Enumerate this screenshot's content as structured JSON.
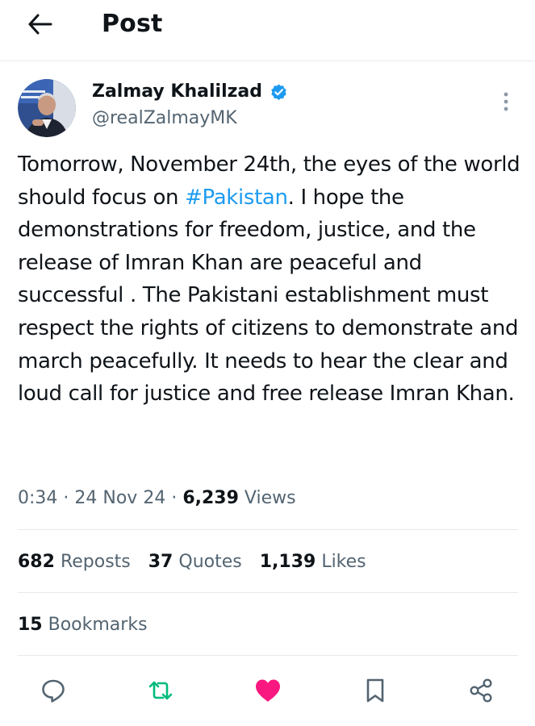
{
  "header": {
    "title": "Post",
    "back_icon": "arrow-left-icon"
  },
  "author": {
    "name": "Zalmay Khalilzad",
    "handle": "@realZalmayMK",
    "verified_icon": "verified-badge-icon",
    "verified_color": "#1d9bf0",
    "more_icon": "more-vertical-icon"
  },
  "post": {
    "text_before": "Tomorrow, November 24th, the eyes of the world should focus on ",
    "hashtag": "#Pakistan",
    "text_after": ". I hope the demonstrations for freedom, justice, and the release of Imran Khan are peaceful and successful . The Pakistani establishment must respect the rights of citizens to demonstrate and march peacefully.  It needs to hear the clear and loud call for justice and free release Imran Khan.",
    "hashtag_color": "#1d9bf0"
  },
  "meta": {
    "time": "0:34",
    "separator": "·",
    "date": "24 Nov 24",
    "views_count": "6,239",
    "views_label": "Views"
  },
  "stats": {
    "reposts_count": "682",
    "reposts_label": "Reposts",
    "quotes_count": "37",
    "quotes_label": "Quotes",
    "likes_count": "1,139",
    "likes_label": "Likes",
    "bookmarks_count": "15",
    "bookmarks_label": "Bookmarks"
  },
  "actions": [
    {
      "icon": "reply-icon",
      "color": "#536471"
    },
    {
      "icon": "repost-icon",
      "color": "#00ba7c"
    },
    {
      "icon": "like-icon-filled",
      "color": "#f91880"
    },
    {
      "icon": "bookmark-icon",
      "color": "#536471"
    },
    {
      "icon": "share-icon",
      "color": "#536471"
    }
  ]
}
